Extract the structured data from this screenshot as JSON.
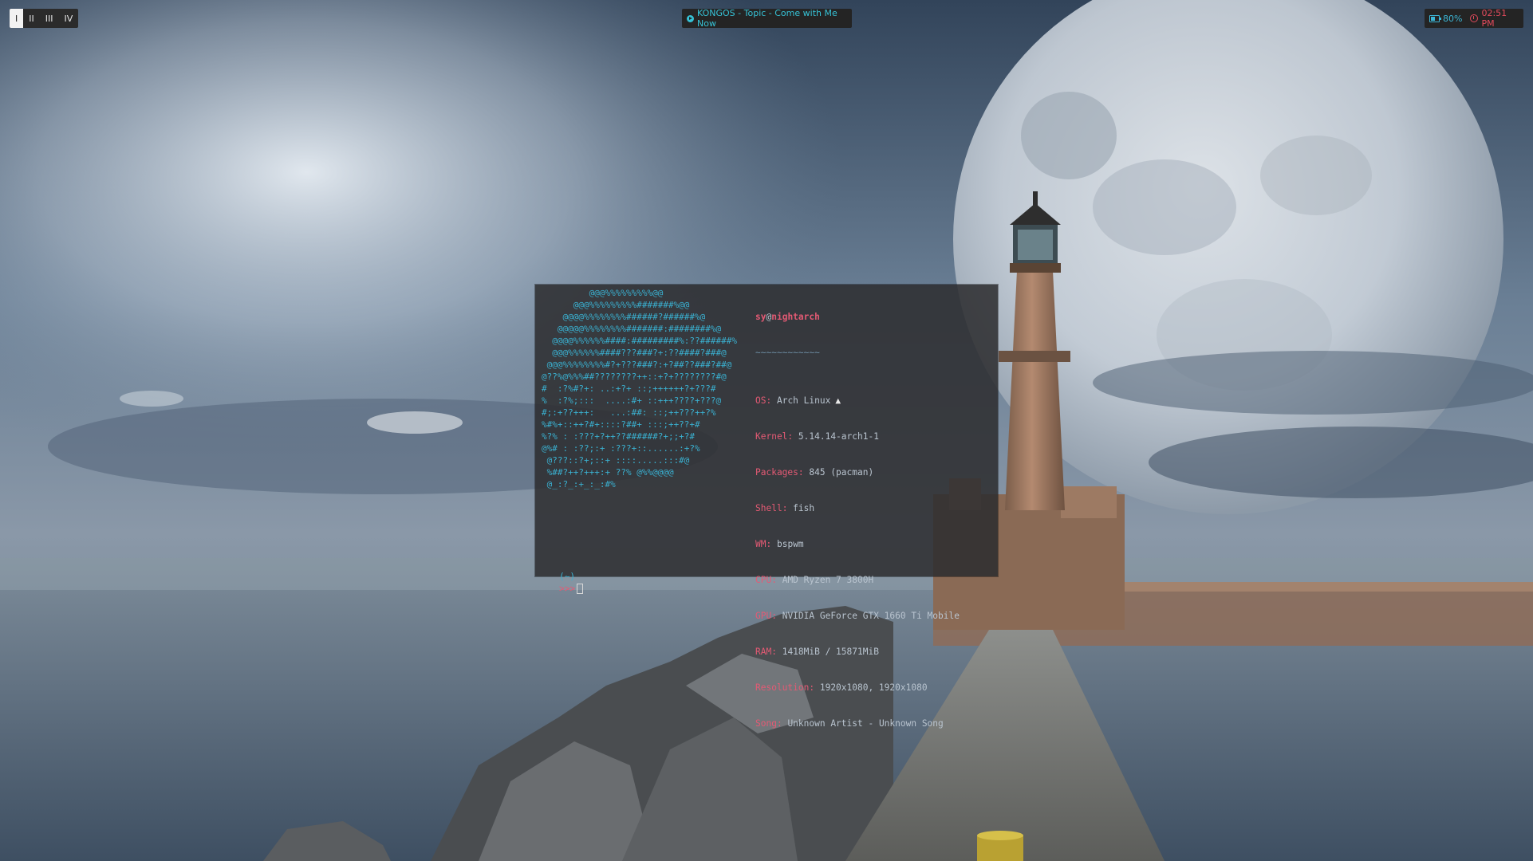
{
  "topbar": {
    "workspaces": [
      {
        "label": "I",
        "active": true
      },
      {
        "label": "II",
        "active": false
      },
      {
        "label": "III",
        "active": false
      },
      {
        "label": "IV",
        "active": false
      }
    ],
    "now_playing": {
      "icon": "play-circle-icon",
      "text": "KONGOS - Topic - Come with Me Now"
    },
    "battery": {
      "icon": "battery-icon",
      "text": "80%"
    },
    "clock": {
      "icon": "clock-icon",
      "text": "02:51 PM"
    }
  },
  "terminal": {
    "ascii_art": "         @@@%%%%%%%%%@@\n      @@@%%%%%%%%%#######%@@\n    @@@@%%%%%%%%######?######%@\n   @@@@@%%%%%%%%#######:########%@\n  @@@@%%%%%%####:#########%:??######%\n  @@@%%%%%%####???###?+:??####?###@\n @@@%%%%%%%%#?+???###?:+?##??###?##@\n@??%@%%%##????????++::+?+????????#@\n#  :?%#?+: ..:+?+ ::;++++++?+???#\n%  :?%;:::  ....:#+ ::+++????+???@\n#;:+??+++:   ...:##: ::;++???++?%\n%#%+::++?#+::::?##+ :::;++??+#\n%?% : :???+?++??######?+;;+?#\n@%# : :??;:+ :???+::......:+?%\n @???::?+;::+ ::::.....:::#@\n %##?++?+++:+ ??% @%%@@@@\n @_:?_:+_:_:#%",
    "user": "sy",
    "at": "@",
    "host": "nightarch",
    "separator": "~~~~~~~~~~~~",
    "fields": [
      {
        "key": "OS",
        "value": "Arch Linux",
        "glyph": "▲"
      },
      {
        "key": "Kernel",
        "value": "5.14.14-arch1-1"
      },
      {
        "key": "Packages",
        "value": "845 (pacman)"
      },
      {
        "key": "Shell",
        "value": "fish"
      },
      {
        "key": "WM",
        "value": "bspwm"
      },
      {
        "key": "CPU",
        "value": "AMD Ryzen 7 3800H"
      },
      {
        "key": "GPU",
        "value": "NVIDIA GeForce GTX 1660 Ti Mobile"
      },
      {
        "key": "RAM",
        "value": "1418MiB / 15871MiB"
      },
      {
        "key": "Resolution",
        "value": "1920x1080, 1920x1080"
      },
      {
        "key": "Song",
        "value": "Unknown Artist - Unknown Song"
      }
    ],
    "prompt": {
      "dir": "(~)",
      "arrow": ">>>"
    }
  },
  "colors": {
    "accent_cyan": "#36c2d6",
    "accent_red": "#e24a5c",
    "terminal_key": "#e45a74",
    "terminal_value": "#b9c4cf",
    "ascii": "#3ab0d0"
  }
}
